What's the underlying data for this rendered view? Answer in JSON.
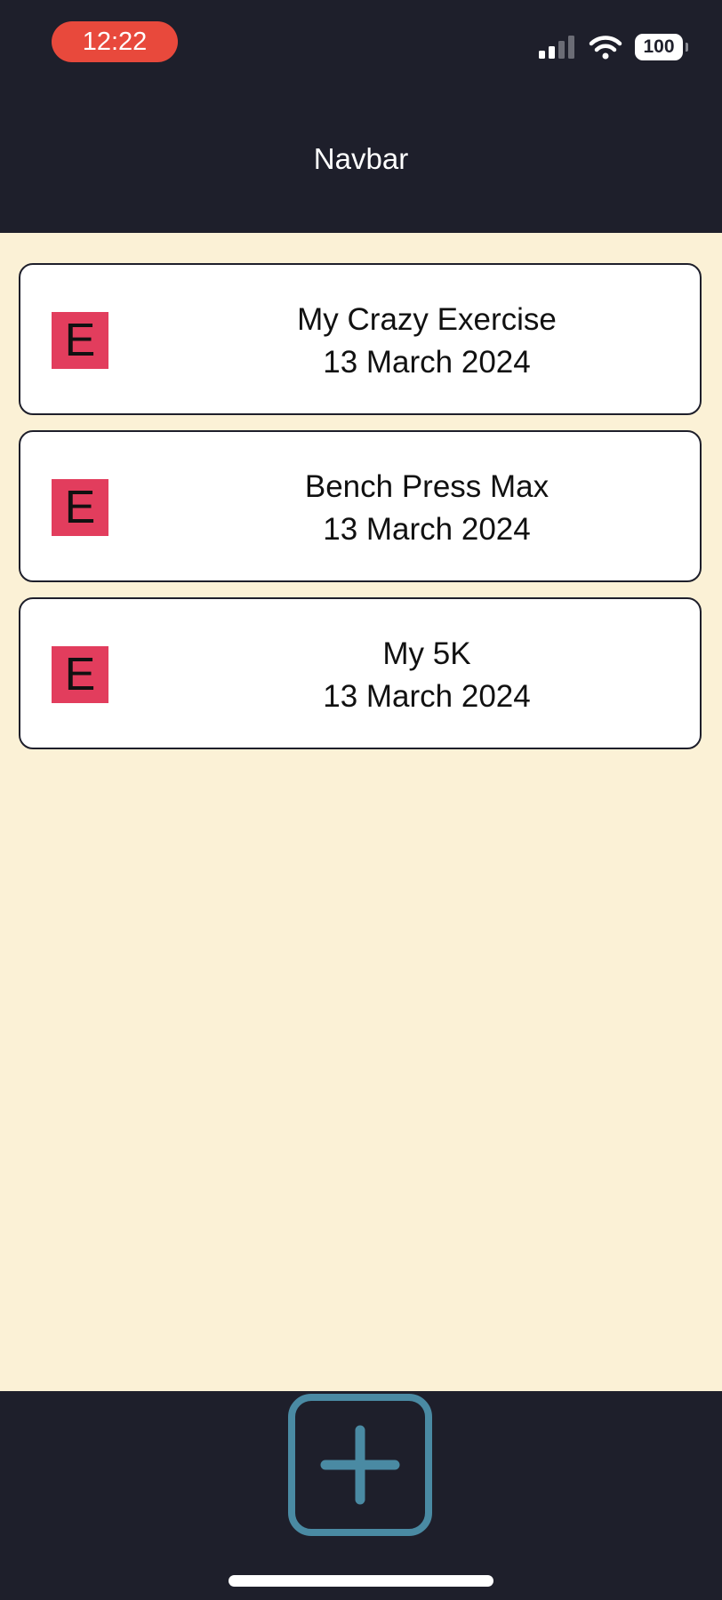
{
  "status_bar": {
    "time": "12:22",
    "battery": "100",
    "icons": [
      "signal-icon",
      "wifi-icon",
      "battery-icon"
    ]
  },
  "navbar": {
    "title": "Navbar"
  },
  "exercises": [
    {
      "badge": "E",
      "name": "My Crazy Exercise",
      "date": "13 March 2024"
    },
    {
      "badge": "E",
      "name": "Bench Press Max",
      "date": "13 March 2024"
    },
    {
      "badge": "E",
      "name": "My 5K",
      "date": "13 March 2024"
    }
  ],
  "footer": {
    "add_icon": "plus-square-icon"
  },
  "colors": {
    "header_bg": "#1e1f2b",
    "content_bg": "#fbf1d6",
    "time_pill": "#e8493c",
    "badge": "#e23d5d",
    "add_button": "#4a8aa3"
  }
}
